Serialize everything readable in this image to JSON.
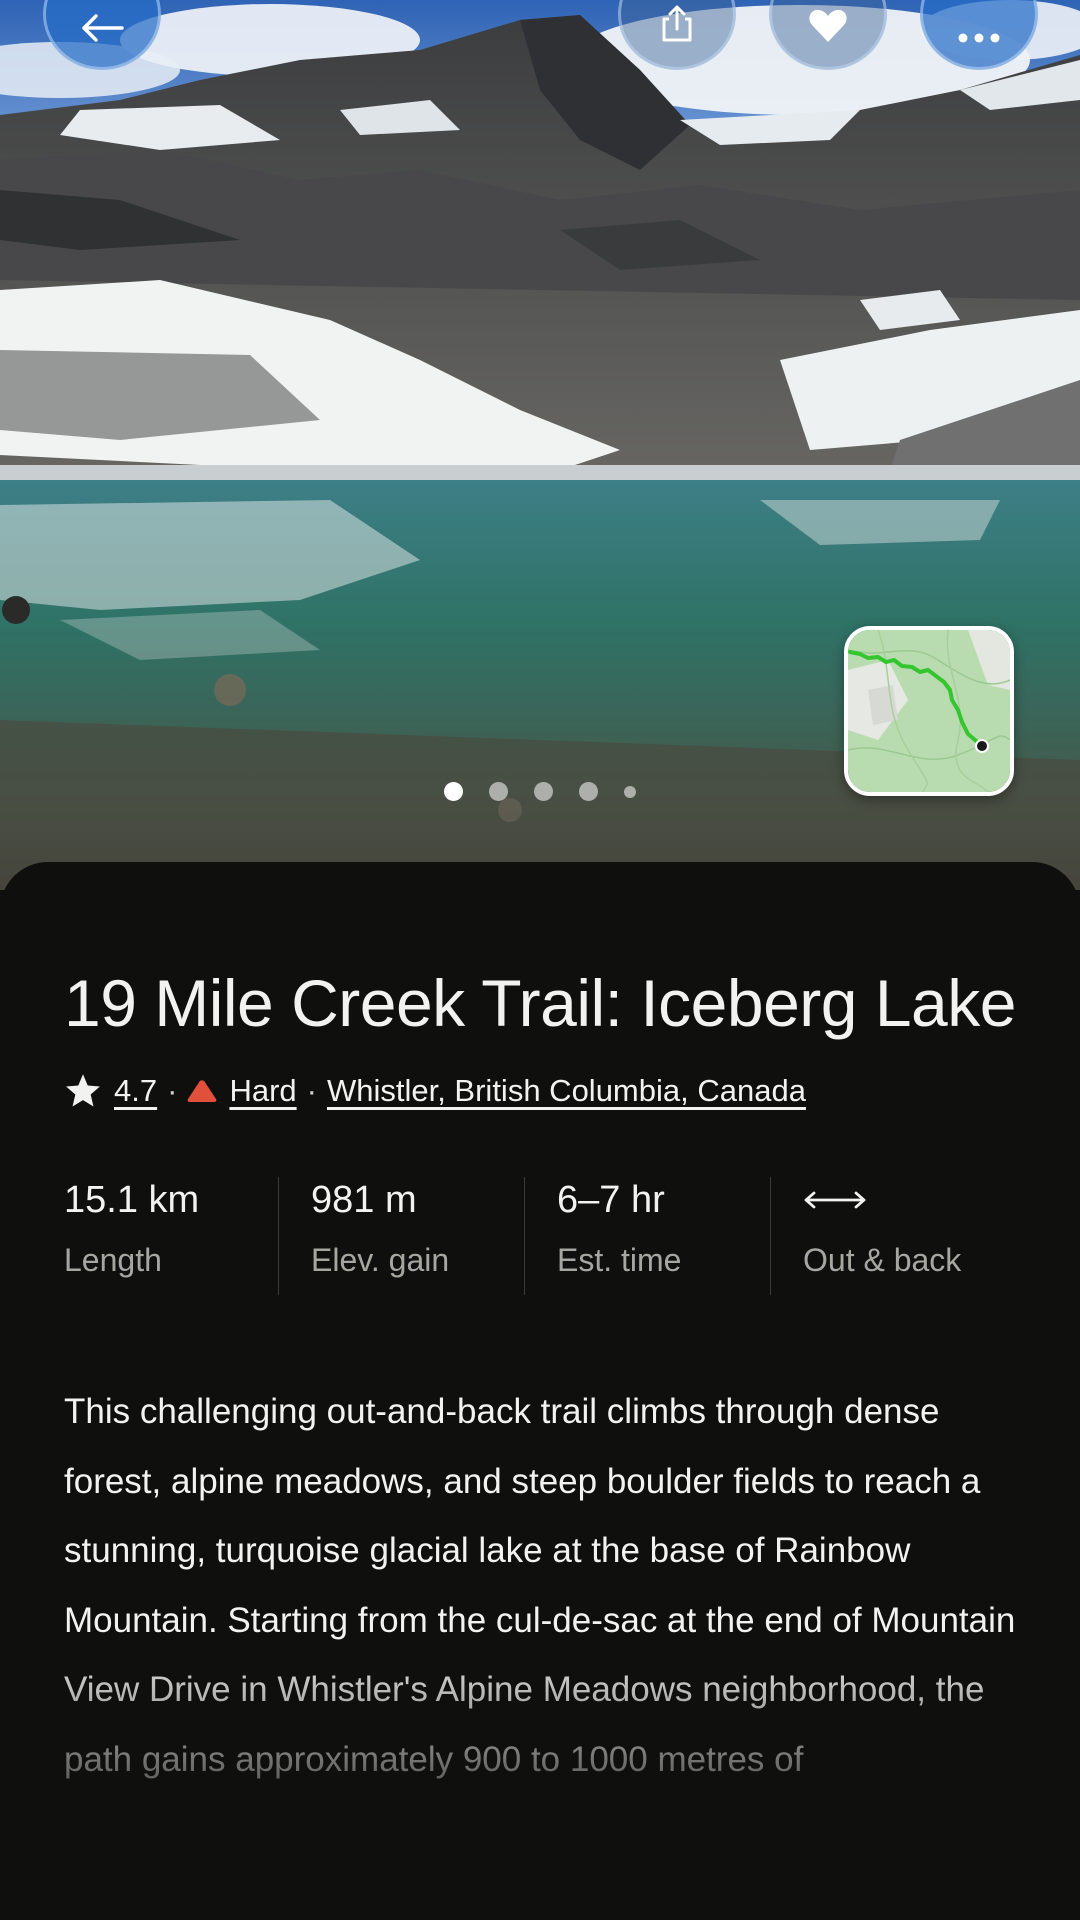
{
  "trail": {
    "name": "19 Mile Creek Trail: Iceberg Lake",
    "rating": "4.7",
    "difficulty": "Hard",
    "location": "Whistler, British Columbia, Canada",
    "description": "This challenging out-and-back trail climbs through dense forest, alpine meadows, and steep boulder fields to reach a stunning, turquoise glacial lake at the base of Rainbow Mountain. Starting from the cul-de-sac at the end of Mountain View Drive in Whistler's Alpine Meadows neighborhood, the path gains approximately 900 to 1000 metres of"
  },
  "stats": [
    {
      "value": "15.1 km",
      "label": "Length"
    },
    {
      "value": "981 m",
      "label": "Elev. gain"
    },
    {
      "value": "6–7 hr",
      "label": "Est. time"
    },
    {
      "value": "",
      "label": "Out & back",
      "icon": "double-arrow-icon"
    }
  ],
  "gallery": {
    "photo_count": 5,
    "active_index": 0
  },
  "colors": {
    "background": "#0f0f0e",
    "text": "#f2f2f0",
    "muted": "#a7a7a2",
    "difficulty_hard": "#e0503a",
    "route_line": "#3fd13a",
    "button": "#266cc6"
  },
  "icons": {
    "back": "arrow-left-icon",
    "share": "share-icon",
    "favorite": "heart-icon",
    "more": "more-dots-icon",
    "rating": "star-icon",
    "difficulty": "mountain-icon"
  }
}
